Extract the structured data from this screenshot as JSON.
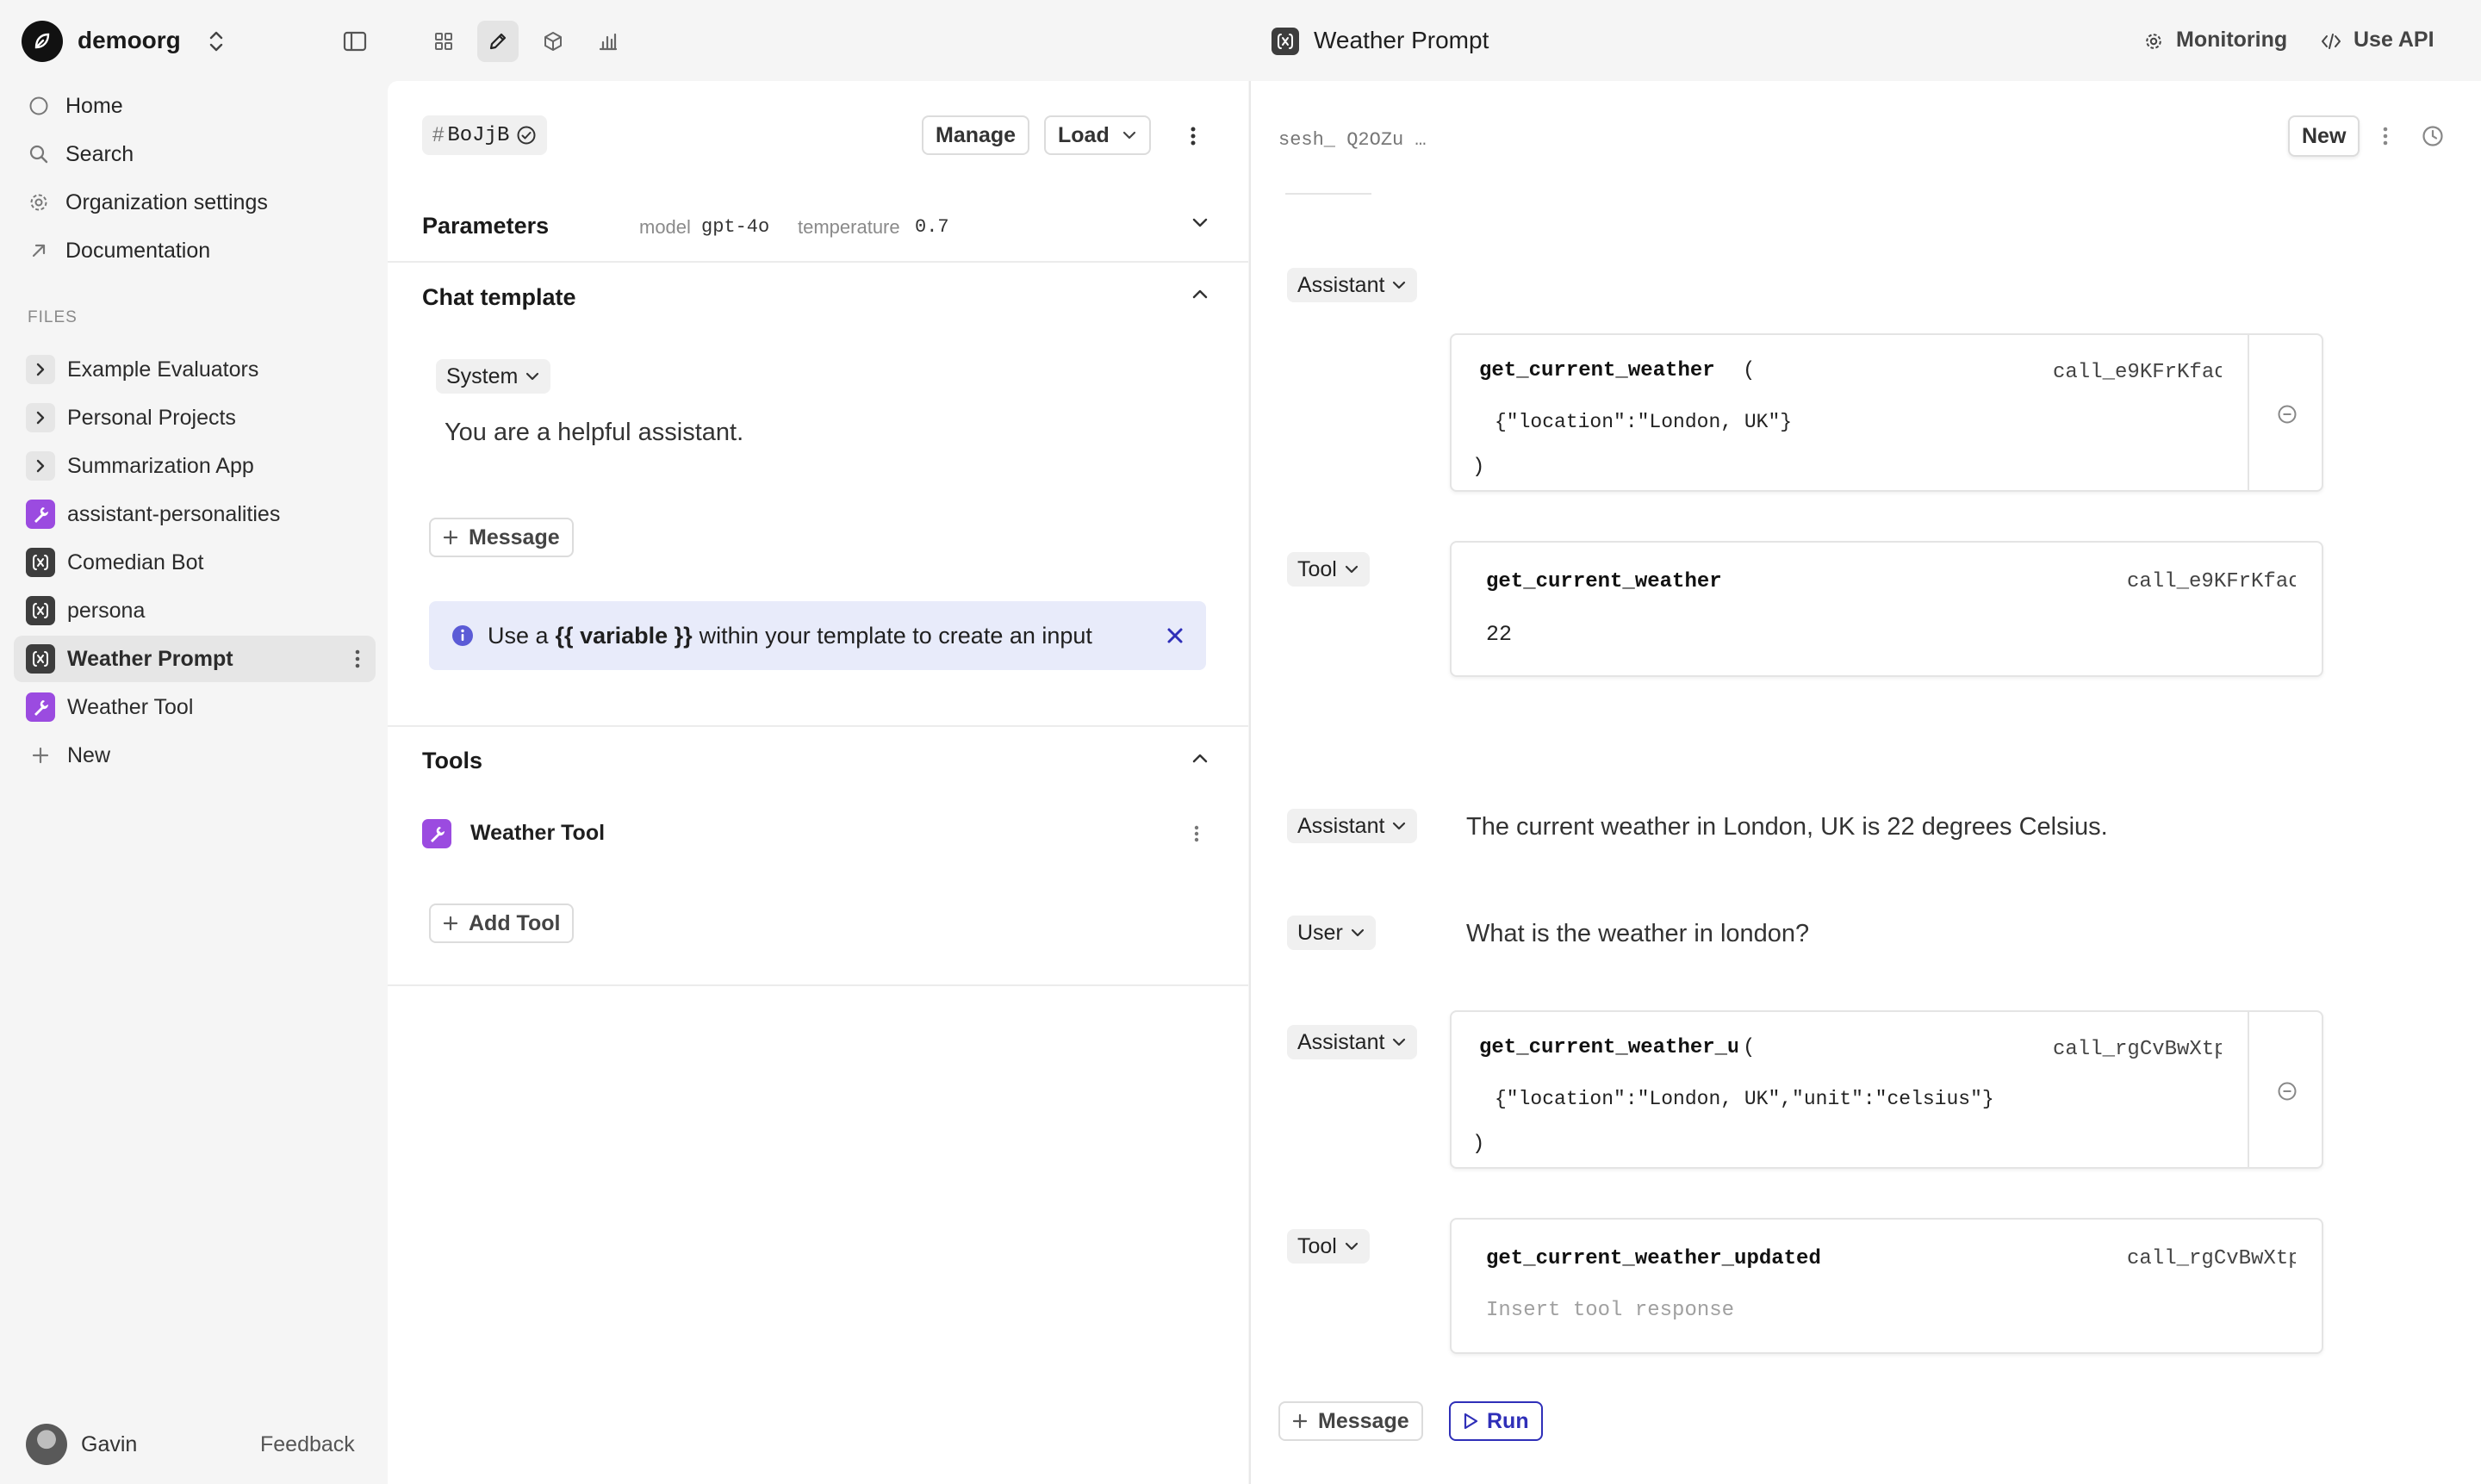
{
  "org": {
    "name": "demoorg"
  },
  "nav": [
    {
      "label": "Home",
      "icon": "circle-icon"
    },
    {
      "label": "Search",
      "icon": "search-icon"
    },
    {
      "label": "Organization settings",
      "icon": "gear-icon"
    },
    {
      "label": "Documentation",
      "icon": "external-arrow-icon"
    }
  ],
  "files": {
    "section_label": "FILES",
    "items": [
      {
        "label": "Example Evaluators",
        "kind": "folder"
      },
      {
        "label": "Personal Projects",
        "kind": "folder"
      },
      {
        "label": "Summarization App",
        "kind": "folder"
      },
      {
        "label": "assistant-personalities",
        "kind": "tool"
      },
      {
        "label": "Comedian Bot",
        "kind": "prompt"
      },
      {
        "label": "persona",
        "kind": "prompt"
      },
      {
        "label": "Weather Prompt",
        "kind": "prompt",
        "active": true
      },
      {
        "label": "Weather Tool",
        "kind": "tool"
      }
    ],
    "new_label": "New"
  },
  "user": {
    "name": "Gavin",
    "feedback_label": "Feedback"
  },
  "topbar": {
    "file_title": "Weather Prompt",
    "monitoring_label": "Monitoring",
    "use_api_label": "Use API"
  },
  "editor": {
    "version_tag": "BoJjB",
    "manage_label": "Manage",
    "load_label": "Load",
    "parameters": {
      "title": "Parameters",
      "model_key": "model",
      "model_value": "gpt-4o",
      "temperature_key": "temperature",
      "temperature_value": "0.7"
    },
    "chat_template": {
      "title": "Chat template",
      "role": "System",
      "content": "You are a helpful assistant.",
      "add_message_label": "Message",
      "hint_prefix": "Use a",
      "hint_variable": "{{ variable }}",
      "hint_suffix": "within your template to create an input"
    },
    "tools": {
      "title": "Tools",
      "item_label": "Weather Tool",
      "add_tool_label": "Add Tool"
    }
  },
  "chat": {
    "session_id": "sesh_ Q2OZu …",
    "new_label": "New",
    "messages": {
      "a1_role": "Assistant",
      "a1_fn": "get_current_weather",
      "a1_paren_open": "(",
      "a1_call_id": "call_e9KFrKfac",
      "a1_args": "{\"location\":\"London, UK\"}",
      "a1_paren_close": ")",
      "t1_role": "Tool",
      "t1_fn": "get_current_weather",
      "t1_call_id": "call_e9KFrKfac",
      "t1_result": "22",
      "a2_role": "Assistant",
      "a2_text": "The current weather in London, UK is 22 degrees Celsius.",
      "u1_role": "User",
      "u1_text": "What is the weather in london?",
      "a3_role": "Assistant",
      "a3_fn": "get_current_weather_u",
      "a3_paren_open": "(",
      "a3_call_id": "call_rgCvBwXtp",
      "a3_args": "{\"location\":\"London, UK\",\"unit\":\"celsius\"}",
      "a3_paren_close": ")",
      "t2_role": "Tool",
      "t2_fn": "get_current_weather_updated",
      "t2_call_id": "call_rgCvBwXtp",
      "t2_placeholder": "Insert tool response"
    },
    "add_message_label": "Message",
    "run_label": "Run"
  },
  "colors": {
    "accent": "#2f2fb8",
    "tool_icon": "#9b4be0",
    "hint_bg": "#e8ebfa"
  }
}
